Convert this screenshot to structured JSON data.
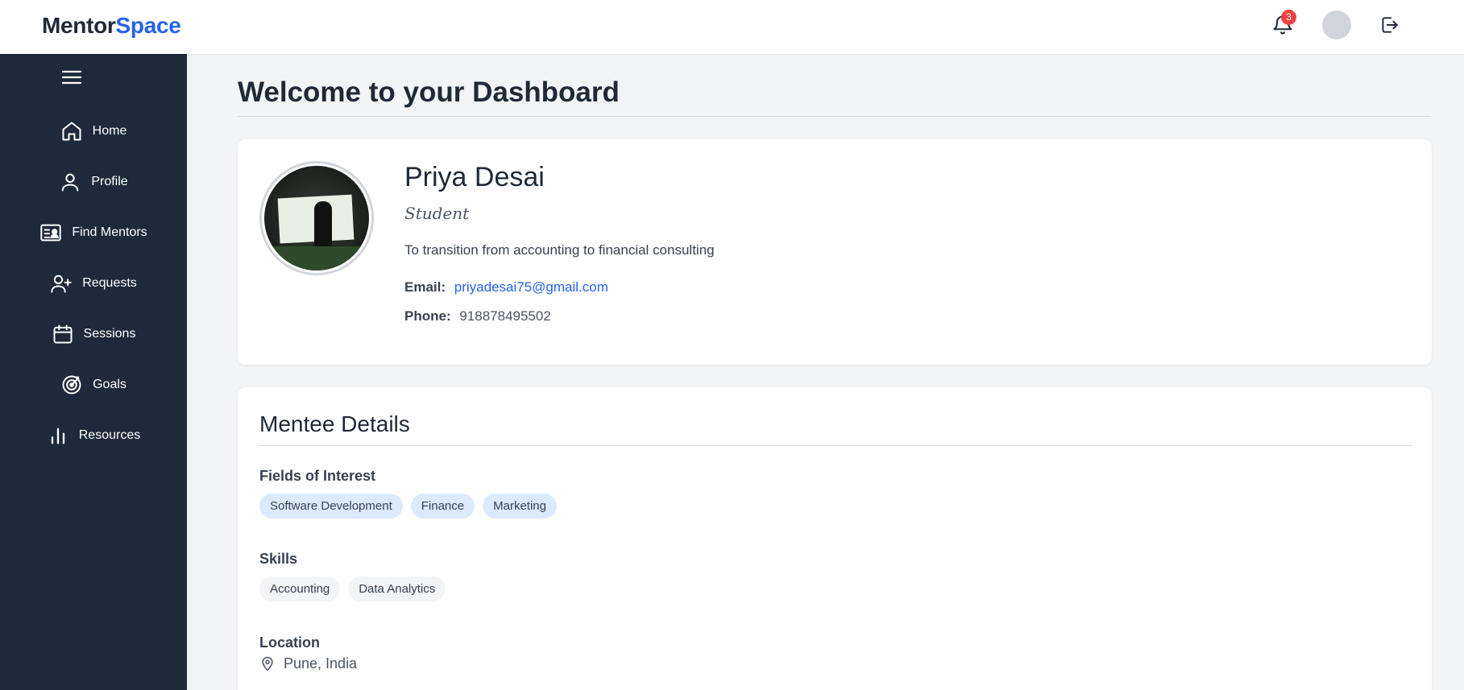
{
  "brand": {
    "part1": "Mentor",
    "part2": "Space"
  },
  "header": {
    "notification_count": "3",
    "icons": [
      "bell-icon",
      "avatar",
      "logout-icon"
    ]
  },
  "sidebar": {
    "items": [
      {
        "label": "Home",
        "icon": "home-icon"
      },
      {
        "label": "Profile",
        "icon": "user-icon"
      },
      {
        "label": "Find Mentors",
        "icon": "id-card-icon"
      },
      {
        "label": "Requests",
        "icon": "user-plus-icon"
      },
      {
        "label": "Sessions",
        "icon": "calendar-icon"
      },
      {
        "label": "Goals",
        "icon": "target-icon"
      },
      {
        "label": "Resources",
        "icon": "bar-chart-icon"
      }
    ]
  },
  "page": {
    "title": "Welcome to your Dashboard"
  },
  "profile": {
    "name": "Priya Desai",
    "role": "Student",
    "goal": "To transition from accounting to financial consulting",
    "email_label": "Email:",
    "email": "priyadesai75@gmail.com",
    "phone_label": "Phone:",
    "phone": "918878495502"
  },
  "mentee": {
    "title": "Mentee Details",
    "interests_label": "Fields of Interest",
    "interests": [
      "Software Development",
      "Finance",
      "Marketing"
    ],
    "skills_label": "Skills",
    "skills": [
      "Accounting",
      "Data Analytics"
    ],
    "location_label": "Location",
    "location": "Pune, India"
  },
  "colors": {
    "sidebar_bg": "#1e293b",
    "accent": "#2563eb",
    "badge": "#ef4444",
    "chip_blue": "#dbeafe",
    "chip_gray": "#f3f4f6"
  }
}
